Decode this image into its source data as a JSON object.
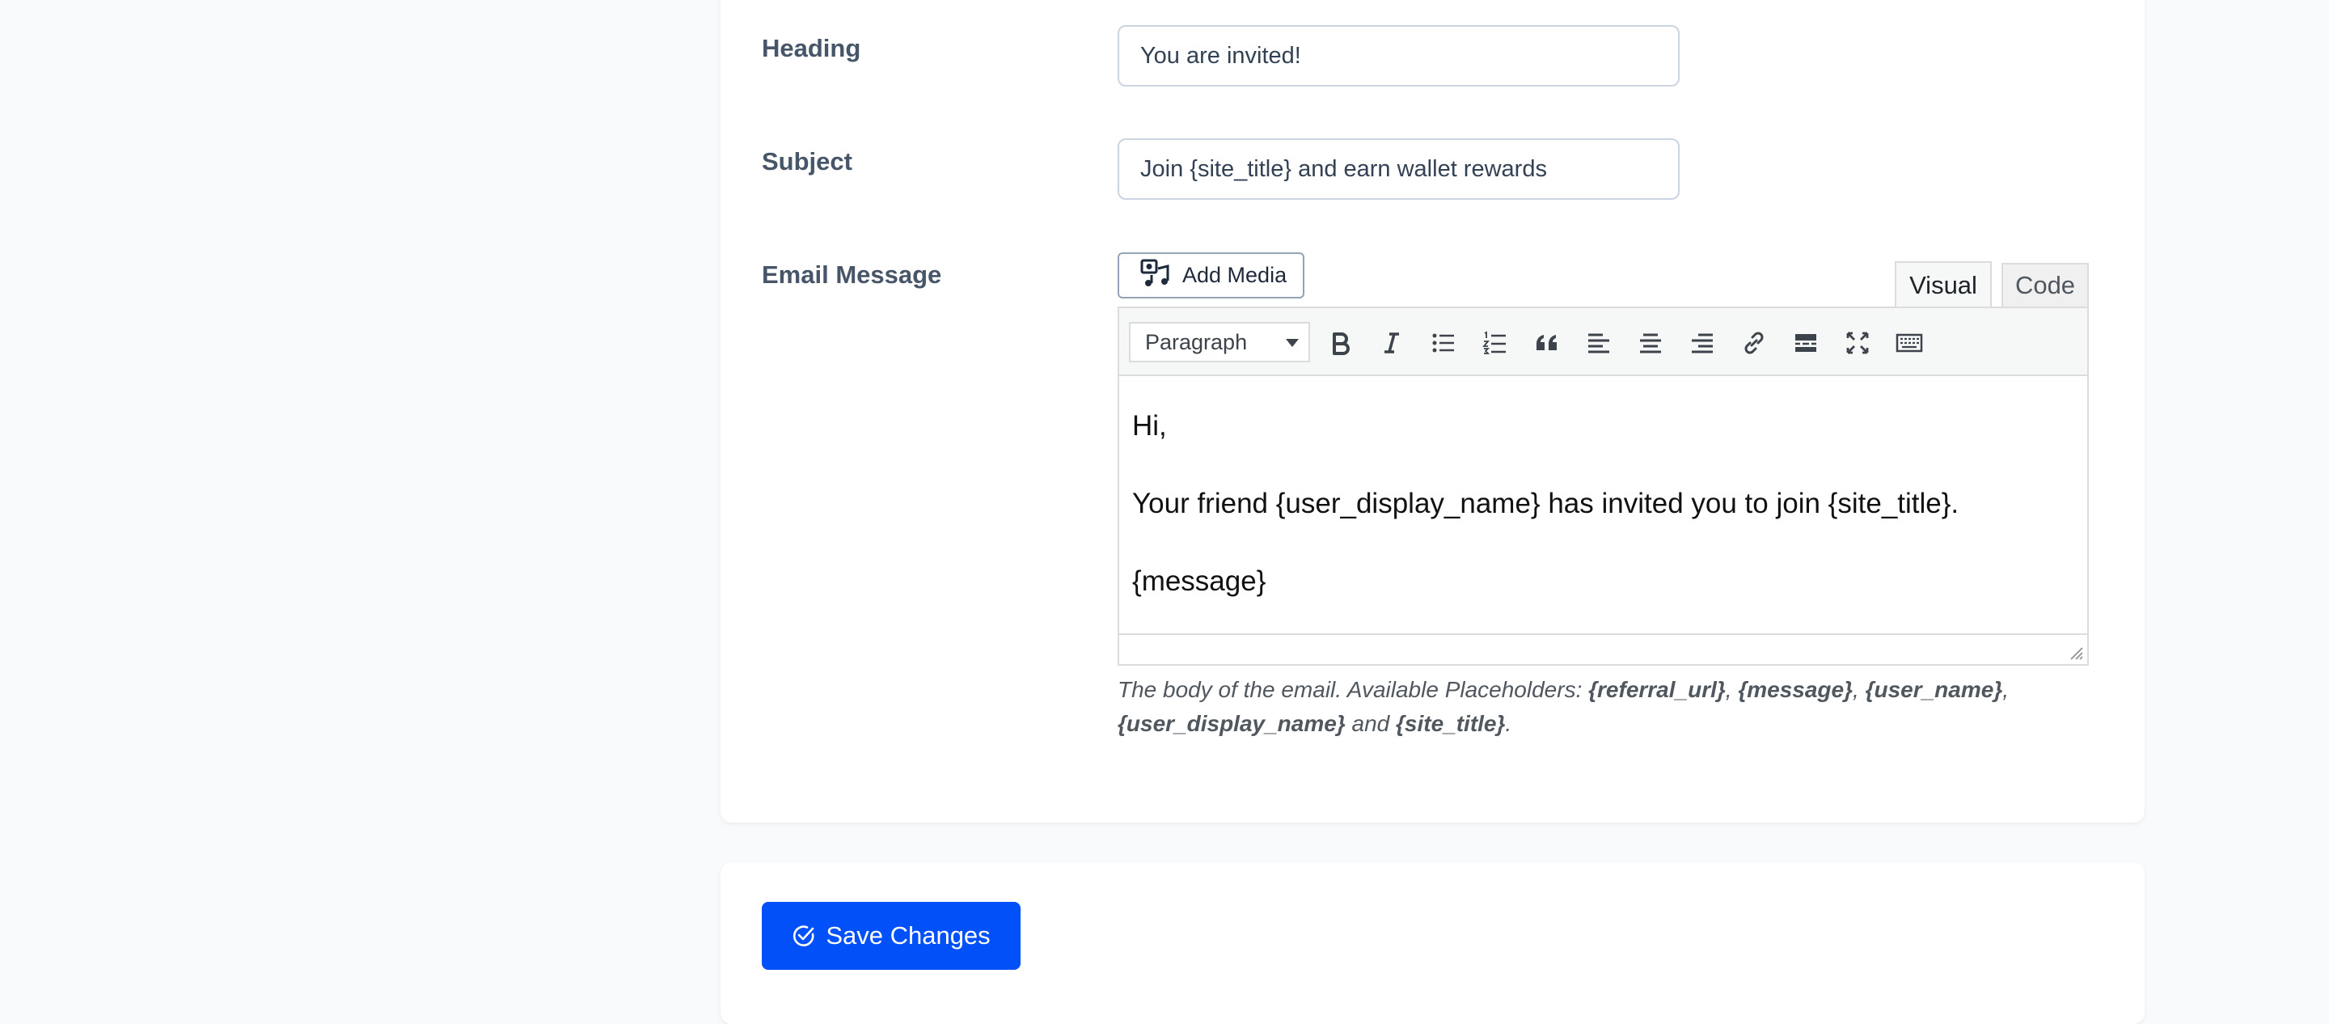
{
  "form": {
    "heading": {
      "label": "Heading",
      "value": "You are invited!"
    },
    "subject": {
      "label": "Subject",
      "value": "Join {site_title} and earn wallet rewards"
    },
    "email_message": {
      "label": "Email Message"
    }
  },
  "editor": {
    "add_media_label": "Add Media",
    "tabs": {
      "visual": "Visual",
      "code": "Code"
    },
    "format_select": "Paragraph",
    "toolbar_icons": [
      "bold-icon",
      "italic-icon",
      "bullet-list-icon",
      "numbered-list-icon",
      "blockquote-icon",
      "align-left-icon",
      "align-center-icon",
      "align-right-icon",
      "link-icon",
      "read-more-icon",
      "fullscreen-icon",
      "toolbar-toggle-icon"
    ],
    "content": {
      "line1": "Hi,",
      "line2": "Your friend {user_display_name} has invited you to join {site_title}.",
      "line3": "{message}"
    }
  },
  "help": {
    "prefix": "The body of the email. Available Placeholders: ",
    "p1": "{referral_url}",
    "sep1": ", ",
    "p2": "{message}",
    "sep2": ", ",
    "p3": "{user_name}",
    "sep3": ", ",
    "p4": "{user_display_name}",
    "and": " and ",
    "p5": "{site_title}",
    "end": "."
  },
  "actions": {
    "save_label": "Save Changes"
  },
  "colors": {
    "primary": "#0250f7",
    "label": "#475569",
    "border": "#cbd5e1"
  }
}
